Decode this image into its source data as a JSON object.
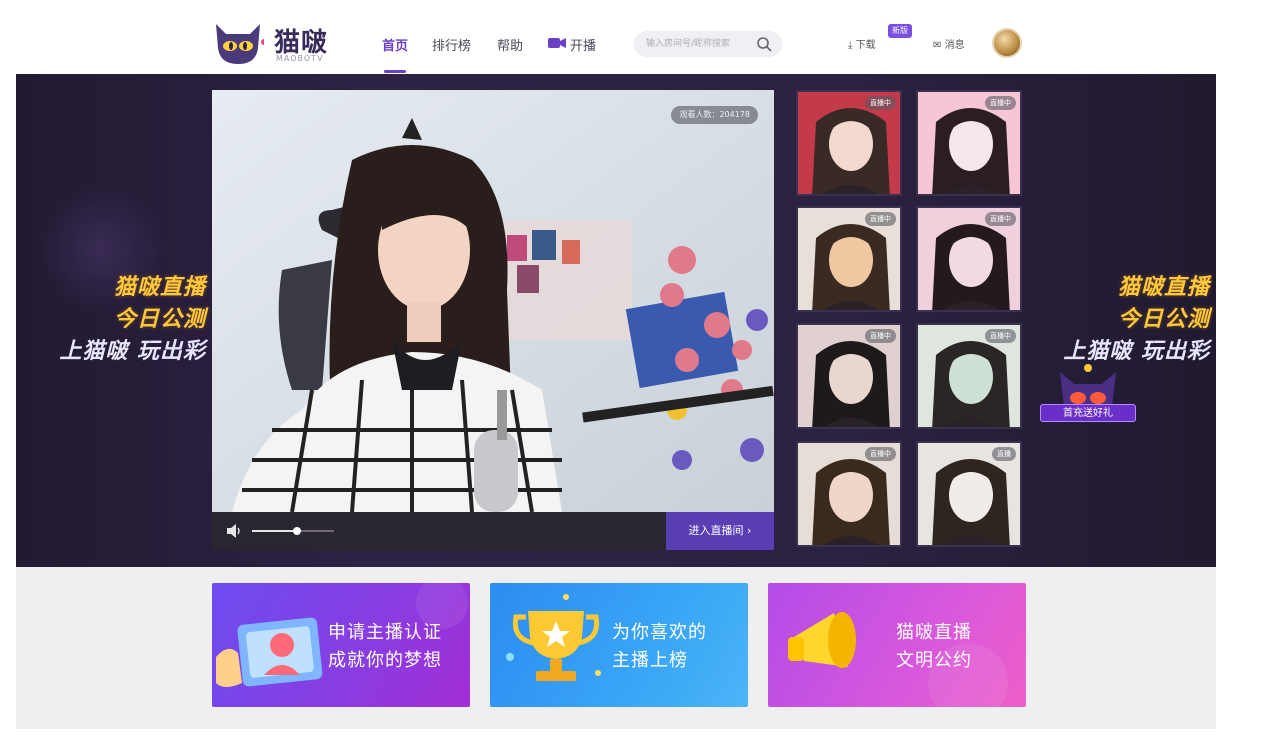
{
  "header": {
    "logo_text": "猫啵",
    "logo_sub": "MAOBOTV",
    "nav": [
      "首页",
      "排行榜",
      "帮助",
      "开播"
    ],
    "search_placeholder": "输入房间号/昵称搜索",
    "download_label": "下载",
    "download_badge": "新版",
    "message_label": "消息"
  },
  "hero": {
    "promo_line1": "猫啵直播",
    "promo_line2": "今日公测",
    "promo_line3": "上猫啵 玩出彩",
    "gift_label": "首充送好礼"
  },
  "video": {
    "viewer_count": "观看人数：204178",
    "enter_button": "进入直播间",
    "volume_level": 0.55
  },
  "thumbnails": [
    {
      "badge": "直播中"
    },
    {
      "badge": "直播中"
    },
    {
      "badge": "直播中"
    },
    {
      "badge": "直播中"
    },
    {
      "badge": "直播中"
    },
    {
      "badge": "直播中"
    },
    {
      "badge": "直播中"
    },
    {
      "badge": "直播"
    }
  ],
  "cards": [
    {
      "line1": "申请主播认证",
      "line2": "成就你的梦想"
    },
    {
      "line1": "为你喜欢的",
      "line2": "主播上榜"
    },
    {
      "line1": "猫啵直播",
      "line2": "文明公约"
    }
  ],
  "colors": {
    "accent": "#6b3fc6",
    "hero_bg": "#2b2140",
    "promo_gold": "#ffc83a"
  }
}
